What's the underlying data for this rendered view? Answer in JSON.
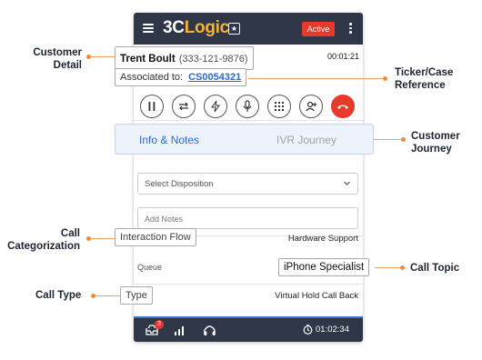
{
  "app": {
    "logo_part1": "3C",
    "logo_part2": "Logic",
    "status": "Active"
  },
  "caller": {
    "name": "Trent Boult",
    "phone": "(333-121-9876)",
    "timer": "00:01:21"
  },
  "association": {
    "label": "Associated to:",
    "case_id": "CS0054321"
  },
  "controls": [
    "pause-icon",
    "transfer-icon",
    "flash-icon",
    "mic-icon",
    "keypad-icon",
    "add-user-icon",
    "hangup-icon"
  ],
  "tabs": {
    "active": "Info & Notes",
    "inactive": "IVR Journey"
  },
  "form": {
    "disposition_placeholder": "Select Disposition",
    "notes_placeholder": "Add Notes"
  },
  "details": {
    "flow_label": "Interaction Flow",
    "flow_value": "Hardware Support",
    "queue_label": "Queue",
    "queue_value": "iPhone Specialist",
    "type_label": "Type",
    "type_value": "Virtual Hold Call Back"
  },
  "bottom": {
    "notification_count": "3",
    "timer": "01:02:34"
  },
  "callouts": {
    "customer_detail_1": "Customer",
    "customer_detail_2": "Detail",
    "ticket_ref_1": "Ticker/Case",
    "ticket_ref_2": "Reference",
    "customer_journey_1": "Customer",
    "customer_journey_2": "Journey",
    "call_cat_1": "Call",
    "call_cat_2": "Categorization",
    "call_topic": "Call Topic",
    "call_type": "Call Type"
  },
  "colors": {
    "topbar": "#2e3647",
    "accent_blue": "#2b6ad9",
    "danger_red": "#e8392a",
    "logo_gold": "#f5b335",
    "callout_orange": "#f08a3c"
  }
}
